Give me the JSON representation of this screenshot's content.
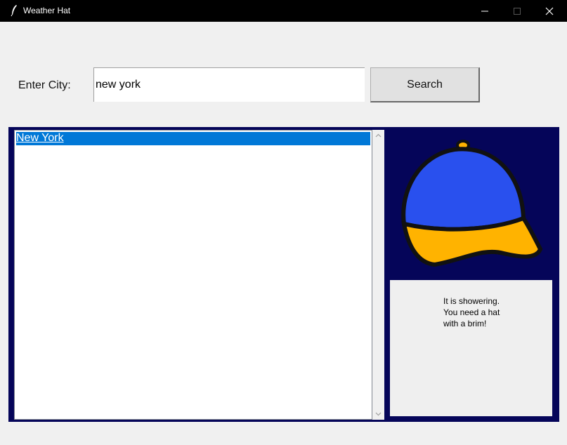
{
  "window": {
    "title": "Weather Hat"
  },
  "form": {
    "city_label": "Enter City:",
    "city_value": "new york",
    "search_label": "Search"
  },
  "results": {
    "items": [
      {
        "label": "New York",
        "selected": true
      }
    ]
  },
  "advice": {
    "message": "It is showering.\nYou need a hat\nwith a brim!"
  },
  "colors": {
    "panel_bg": "#050559",
    "selection": "#0078d7",
    "hat_crown": "#2950ee",
    "hat_brim": "#ffb300"
  }
}
